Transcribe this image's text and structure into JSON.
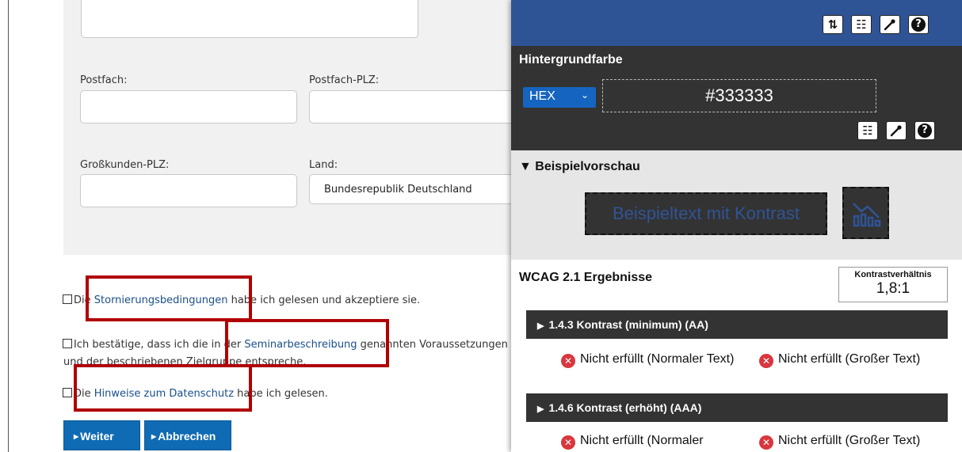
{
  "form": {
    "postfach_label": "Postfach:",
    "postfach_plz_label": "Postfach-PLZ:",
    "grosskunden_plz_label": "Großkunden-PLZ:",
    "land_label": "Land:",
    "land_value": "Bundesrepublik Deutschland",
    "consent1": {
      "pre": "Die ",
      "link": "Stornierungsbedingungen",
      "post": " habe ich gelesen und akzeptiere sie."
    },
    "consent2": {
      "pre": "Ich bestätige, dass ich die in der ",
      "link": "Seminarbeschreibung",
      "post": " genannten Voraussetzungen",
      "line2": "und der beschriebenen Zielgruppe entspreche."
    },
    "consent3": {
      "pre": "Die ",
      "link": "Hinweise zum Datenschutz",
      "post": " habe ich gelesen."
    },
    "weiter_label": "Weiter",
    "abbrechen_label": "Abbrechen"
  },
  "checker": {
    "toolbar_icons": [
      "swap-icon",
      "sliders-icon",
      "eyedropper-icon",
      "help-icon"
    ],
    "bg_title": "Hintergrundfarbe",
    "format": "HEX",
    "hex_value": "#333333",
    "preview_title": "Beispielvorschau",
    "preview_text": "Beispieltext mit Kontrast",
    "wcag_title": "WCAG 2.1 Ergebnisse",
    "ratio_label": "Kontrastverhältnis",
    "ratio_value": "1,8:1",
    "criteria": [
      {
        "label": "1.4.3 Kontrast (minimum) (AA)",
        "normal": "Nicht erfüllt (Normaler Text)",
        "large": "Nicht erfüllt (Großer Text)"
      },
      {
        "label": "1.4.6 Kontrast (erhöht) (AAA)",
        "normal": "Nicht erfüllt (Normaler",
        "large": "Nicht erfüllt (Großer Text)"
      }
    ],
    "colors": {
      "topbar": "#2f5496",
      "panel_dark": "#333333",
      "fail": "#d9363e",
      "link": "#1a4f8b",
      "highlight": "#b00000"
    }
  }
}
